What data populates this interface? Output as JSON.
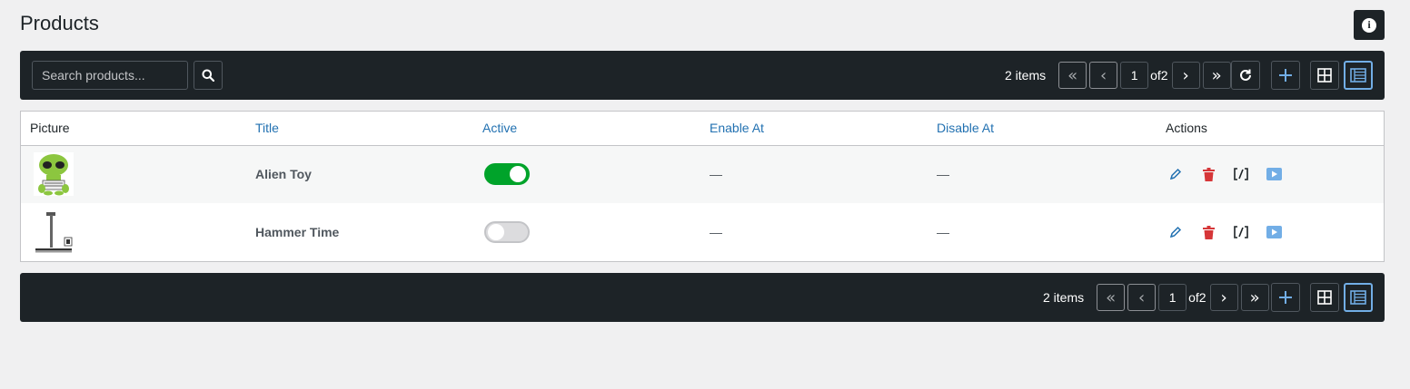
{
  "page": {
    "title": "Products"
  },
  "header": {
    "info_icon": "info-icon"
  },
  "search": {
    "placeholder": "Search products...",
    "value": ""
  },
  "pagination": {
    "items_label": "2 items",
    "first": "«",
    "prev": "‹",
    "current_page": "1",
    "of_label": "of2",
    "next": "›",
    "last": "»"
  },
  "toolbar_icons": {
    "refresh": "refresh-icon",
    "add": "plus-icon",
    "grid_view": "grid-view-icon",
    "list_view": "list-view-icon"
  },
  "table": {
    "columns": [
      "Picture",
      "Title",
      "Active",
      "Enable At",
      "Disable At",
      "Actions"
    ],
    "rows": [
      {
        "title": "Alien Toy",
        "active": true,
        "enable_at": "—",
        "disable_at": "—",
        "picture": "alien-toy-image"
      },
      {
        "title": "Hammer Time",
        "active": false,
        "enable_at": "—",
        "disable_at": "—",
        "picture": "hammer-image"
      }
    ],
    "row_actions": [
      "edit-icon",
      "delete-icon",
      "shortcode-icon",
      "preview-icon"
    ]
  },
  "colors": {
    "toolbar_bg": "#1d2327",
    "link": "#2271b1",
    "toggle_on": "#00a32a",
    "delete": "#d63638",
    "active_view": "#72aee6"
  }
}
